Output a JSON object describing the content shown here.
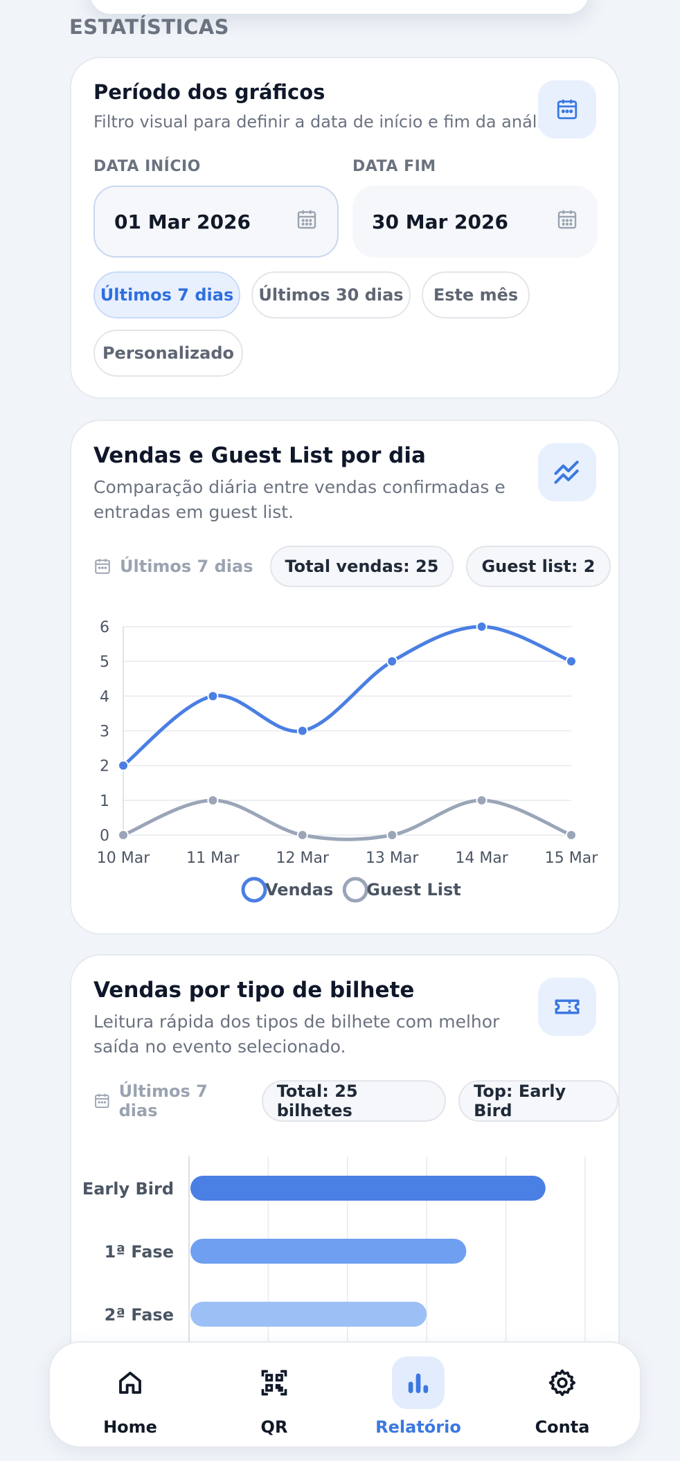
{
  "section": {
    "title": "ESTATÍSTICAS"
  },
  "period_card": {
    "title": "Período dos gráficos",
    "subtitle": "Filtro visual para definir a data de início e fim da análise.",
    "start_label": "DATA INÍCIO",
    "start_value": "01 Mar 2026",
    "end_label": "DATA FIM",
    "end_value": "30 Mar 2026",
    "chips": [
      "Últimos 7 dias",
      "Últimos 30 dias",
      "Este mês",
      "Personalizado"
    ],
    "active_chip": "Últimos 7 dias",
    "icon": "calendar-icon"
  },
  "sales_card": {
    "title": "Vendas e Guest List por dia",
    "subtitle_line1": "Comparação diária entre vendas confirmadas e",
    "subtitle_line2": "entradas em guest list.",
    "period": "Últimos 7 dias",
    "total_pill": "Total vendas: 25",
    "guest_pill": "Guest list: 2",
    "icon": "trend-icon"
  },
  "ticket_card": {
    "title": "Vendas por tipo de bilhete",
    "subtitle_line1": "Leitura rápida dos tipos de bilhete com melhor",
    "subtitle_line2": "saída no evento selecionado.",
    "period": "Últimos 7 dias",
    "total_pill": "Total: 25 bilhetes",
    "top_pill": "Top: Early Bird",
    "icon": "ticket-icon"
  },
  "chart_data": [
    {
      "type": "line",
      "x": [
        "10 Mar",
        "11 Mar",
        "12 Mar",
        "13 Mar",
        "14 Mar",
        "15 Mar"
      ],
      "series": [
        {
          "name": "Vendas",
          "values": [
            2,
            4,
            3,
            5,
            6,
            5
          ],
          "color": "#4a7fe3"
        },
        {
          "name": "Guest List",
          "values": [
            0,
            1,
            0,
            0,
            1,
            0
          ],
          "color": "#9aa5b8"
        }
      ],
      "ylim": [
        0,
        6
      ],
      "yticks": [
        "0",
        "1",
        "2",
        "3",
        "4",
        "5",
        "6"
      ],
      "grid": true,
      "legend": "bottom-center"
    },
    {
      "type": "bar",
      "orientation": "horizontal",
      "categories": [
        "Early Bird",
        "1ª Fase",
        "2ª Fase"
      ],
      "values": [
        9,
        7,
        6
      ],
      "colors": [
        "#4a7fe3",
        "#6e9ff0",
        "#9cc0f6"
      ],
      "xlim": [
        0,
        10
      ],
      "grid": true
    }
  ],
  "nav": {
    "items": [
      {
        "label": "Home",
        "icon": "home-icon"
      },
      {
        "label": "QR",
        "icon": "qr-icon"
      },
      {
        "label": "Relatório",
        "icon": "bar-chart-icon"
      },
      {
        "label": "Conta",
        "icon": "gear-icon"
      }
    ],
    "active": "Relatório"
  },
  "colors": {
    "accent": "#3b78e0",
    "accent_light": "#e8f0fe",
    "muted": "#6b7280"
  }
}
